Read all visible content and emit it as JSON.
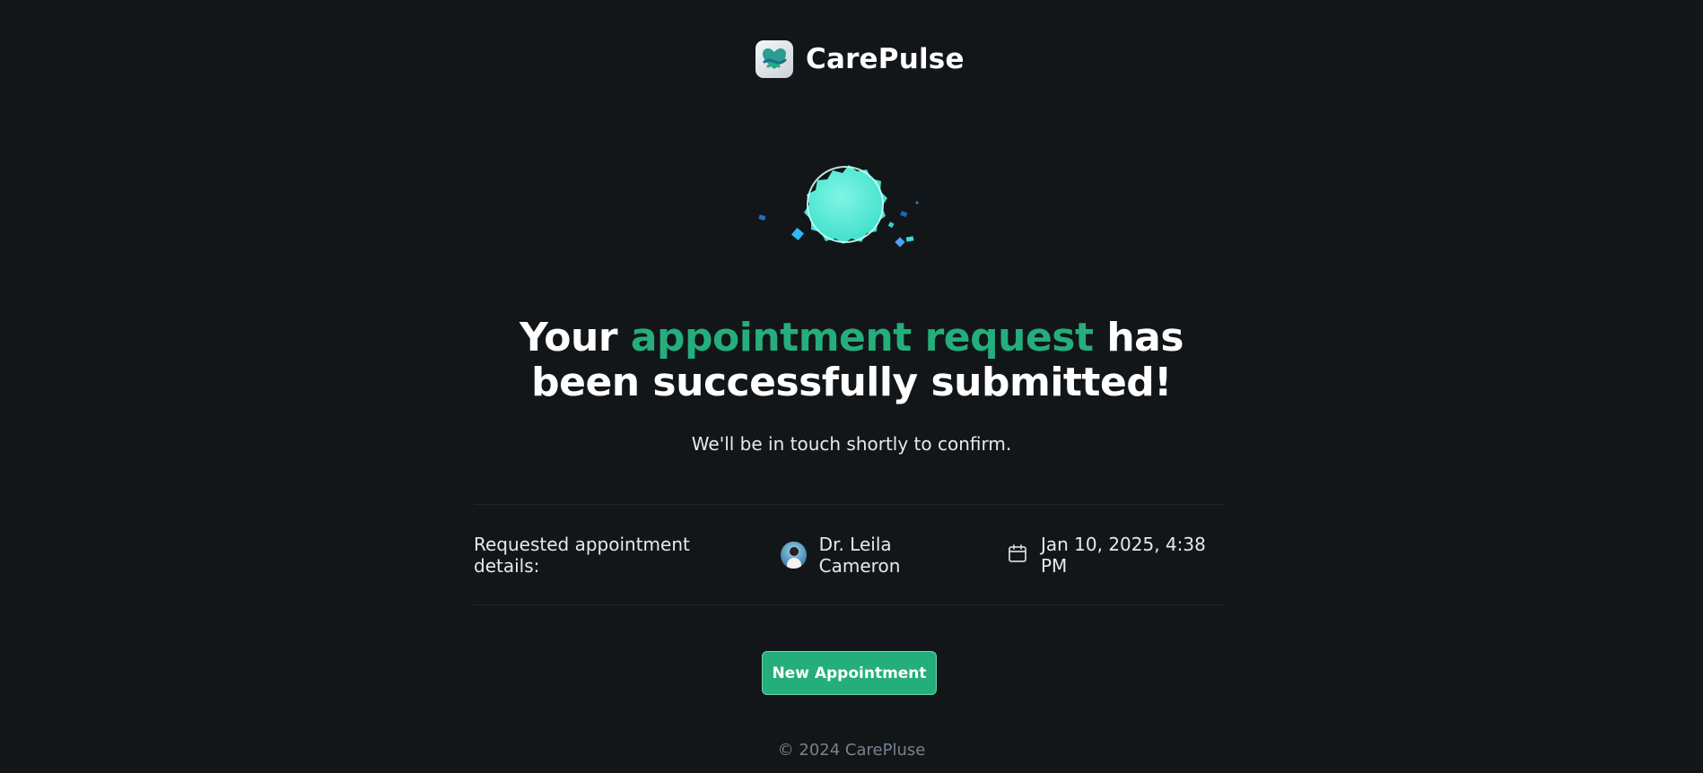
{
  "brand": {
    "name": "CarePulse",
    "logo_icon": "heart-hands-icon"
  },
  "status_icon": "success-badge-icon",
  "headline": {
    "before": "Your ",
    "accent": "appointment request",
    "after": " has been successfully submitted!"
  },
  "subtext": "We'll be in touch shortly to confirm.",
  "details": {
    "label": "Requested appointment details:",
    "doctor_name": "Dr. Leila Cameron",
    "doctor_avatar": "doctor-avatar",
    "date_icon": "calendar-icon",
    "datetime": "Jan 10, 2025, 4:38 PM"
  },
  "actions": {
    "new_appointment_label": "New Appointment"
  },
  "footer": "© 2024 CarePluse",
  "colors": {
    "background": "#131619",
    "accent": "#24ae7c",
    "badge": "#4ae8d6",
    "text_muted": "#76828d"
  }
}
